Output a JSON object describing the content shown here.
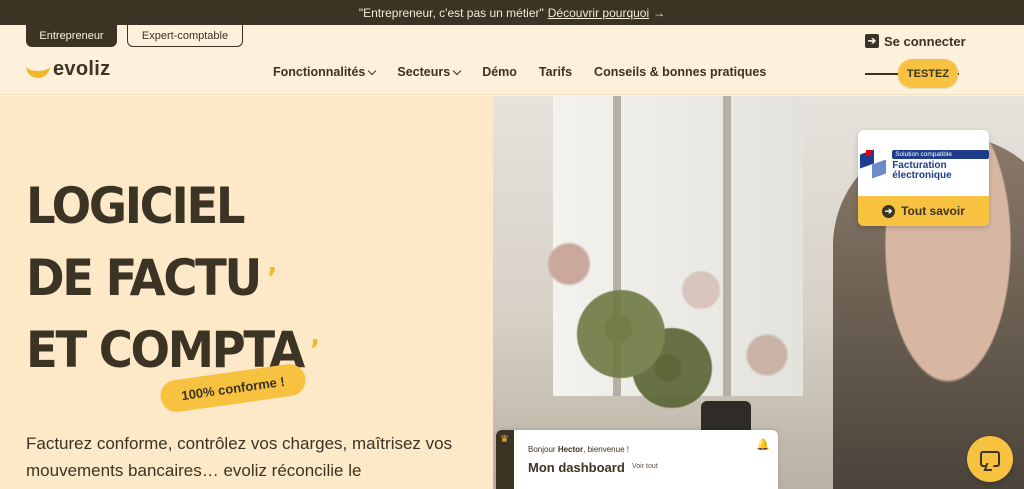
{
  "announcement": {
    "text": "\"Entrepreneur, c'est pas un métier\"",
    "link_label": "Découvrir pourquoi",
    "arrow_icon": "→"
  },
  "audience_switch": {
    "active_label": "Entrepreneur",
    "inactive_label": "Expert-comptable"
  },
  "header": {
    "login_icon": "➔",
    "login_label": "Se connecter",
    "brand": "evoliz",
    "nav": [
      {
        "label": "Fonctionnalités",
        "has_dropdown": true
      },
      {
        "label": "Secteurs",
        "has_dropdown": true
      },
      {
        "label": "Démo",
        "has_dropdown": false
      },
      {
        "label": "Tarifs",
        "has_dropdown": false
      },
      {
        "label": "Conseils & bonnes pratiques",
        "has_dropdown": false
      }
    ],
    "cta_label": "TESTEZ"
  },
  "hero": {
    "headline_lines": [
      "LOGICIEL",
      "DE FACTU",
      "ET COMPTA"
    ],
    "headline_accent": "’",
    "badge": "100% conforme !",
    "paragraph": "Facturez conforme, contrôlez vos charges, maîtrisez vos mouvements bancaires… evoliz réconcilie le"
  },
  "compliance_card": {
    "tag": "Solution compatible",
    "title": "Facturation électronique",
    "button_icon": "➔",
    "button_label": "Tout savoir"
  },
  "dashboard_preview": {
    "crown_icon": "♛",
    "greeting_prefix": "Bonjour",
    "user_name": "Hector",
    "greeting_suffix": ", bienvenue !",
    "title": "Mon dashboard",
    "see_all": "Voir tout",
    "bell_icon": "🔔"
  },
  "colors": {
    "brand_dark": "#3b3323",
    "accent_yellow": "#f7c23f",
    "hero_bg": "#fde9c7",
    "page_bg": "#fdf1dc",
    "fe_blue": "#1f3d8a",
    "fe_red": "#e1000f"
  },
  "icons": {
    "chat": "chat-bubble-icon"
  }
}
